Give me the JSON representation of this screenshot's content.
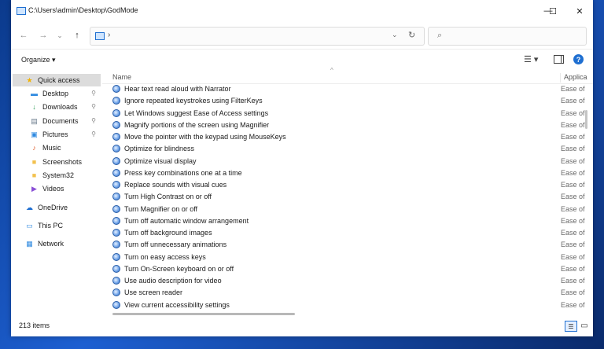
{
  "window": {
    "title": "C:\\Users\\admin\\Desktop\\GodMode"
  },
  "titlebar": {
    "minimize": "—",
    "maximize": "☐",
    "close": "✕"
  },
  "nav": {
    "back": "←",
    "forward": "→",
    "recent": "⌄",
    "up": "↑",
    "address_sep": "›",
    "address_dropdown": "⌄",
    "refresh": "↻",
    "search_placeholder": "",
    "search_glyph": "⌕"
  },
  "toolbar": {
    "organize": "Organize ▾",
    "view_glyph": "☰ ▾",
    "help": "?"
  },
  "sidebar": {
    "items": [
      {
        "label": "Quick access",
        "icon": "star-icon",
        "glyph": "★",
        "color": "#f2b200",
        "pinned": false,
        "selected": true
      },
      {
        "label": "Desktop",
        "icon": "desktop-icon",
        "glyph": "▬",
        "color": "#2f8ae0",
        "pinned": true,
        "selected": false
      },
      {
        "label": "Downloads",
        "icon": "download-icon",
        "glyph": "↓",
        "color": "#2f9e57",
        "pinned": true,
        "selected": false
      },
      {
        "label": "Documents",
        "icon": "document-icon",
        "glyph": "▤",
        "color": "#6a7b8c",
        "pinned": true,
        "selected": false
      },
      {
        "label": "Pictures",
        "icon": "pictures-icon",
        "glyph": "▣",
        "color": "#2f8ae0",
        "pinned": true,
        "selected": false
      },
      {
        "label": "Music",
        "icon": "music-icon",
        "glyph": "♪",
        "color": "#e0602f",
        "pinned": false,
        "selected": false
      },
      {
        "label": "Screenshots",
        "icon": "folder-icon",
        "glyph": "■",
        "color": "#f2c14e",
        "pinned": false,
        "selected": false
      },
      {
        "label": "System32",
        "icon": "folder-icon",
        "glyph": "■",
        "color": "#f2c14e",
        "pinned": false,
        "selected": false
      },
      {
        "label": "Videos",
        "icon": "videos-icon",
        "glyph": "▶",
        "color": "#8a4fd6",
        "pinned": false,
        "selected": false
      },
      {
        "label": "OneDrive",
        "icon": "cloud-icon",
        "glyph": "☁",
        "color": "#1f6fd1",
        "pinned": false,
        "selected": false
      },
      {
        "label": "This PC",
        "icon": "pc-icon",
        "glyph": "▭",
        "color": "#2f8ae0",
        "pinned": false,
        "selected": false
      },
      {
        "label": "Network",
        "icon": "network-icon",
        "glyph": "▦",
        "color": "#2f8ae0",
        "pinned": false,
        "selected": false
      }
    ],
    "pin_glyph": "📌"
  },
  "columns": {
    "name": "Name",
    "application": "Applica"
  },
  "rows": [
    {
      "name": "Hear text read aloud with Narrator",
      "app": "Ease of"
    },
    {
      "name": "Ignore repeated keystrokes using FilterKeys",
      "app": "Ease of"
    },
    {
      "name": "Let Windows suggest Ease of Access settings",
      "app": "Ease of"
    },
    {
      "name": "Magnify portions of the screen using Magnifier",
      "app": "Ease of"
    },
    {
      "name": "Move the pointer with the keypad using MouseKeys",
      "app": "Ease of"
    },
    {
      "name": "Optimize for blindness",
      "app": "Ease of"
    },
    {
      "name": "Optimize visual display",
      "app": "Ease of"
    },
    {
      "name": "Press key combinations one at a time",
      "app": "Ease of"
    },
    {
      "name": "Replace sounds with visual cues",
      "app": "Ease of"
    },
    {
      "name": "Turn High Contrast on or off",
      "app": "Ease of"
    },
    {
      "name": "Turn Magnifier on or off",
      "app": "Ease of"
    },
    {
      "name": "Turn off automatic window arrangement",
      "app": "Ease of"
    },
    {
      "name": "Turn off background images",
      "app": "Ease of"
    },
    {
      "name": "Turn off unnecessary animations",
      "app": "Ease of"
    },
    {
      "name": "Turn on easy access keys",
      "app": "Ease of"
    },
    {
      "name": "Turn On-Screen keyboard on or off",
      "app": "Ease of"
    },
    {
      "name": "Use audio description for video",
      "app": "Ease of"
    },
    {
      "name": "Use screen reader",
      "app": "Ease of"
    },
    {
      "name": "View current accessibility settings",
      "app": "Ease of"
    }
  ],
  "status": {
    "count": "213 items"
  }
}
